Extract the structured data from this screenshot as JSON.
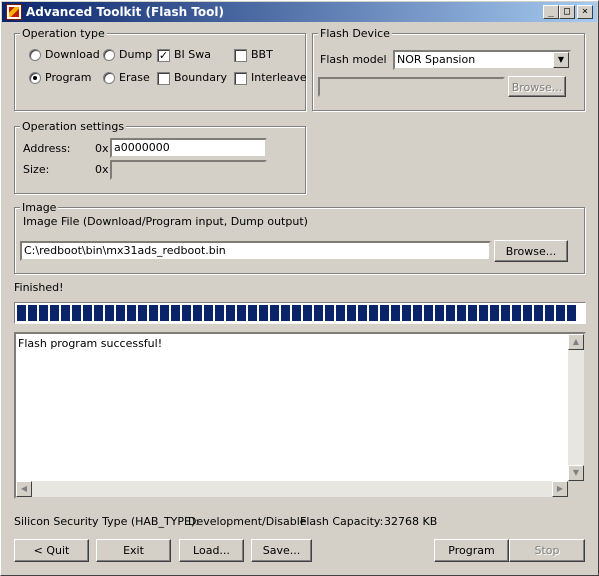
{
  "window": {
    "title": "Advanced Toolkit (Flash Tool)",
    "min_glyph": "_",
    "max_glyph": "□",
    "close_glyph": "×"
  },
  "operation_type": {
    "legend": "Operation type",
    "download": "Download",
    "dump": "Dump",
    "program": "Program",
    "erase": "Erase",
    "bi_swap": "BI Swap",
    "bbt": "BBT",
    "boundary": "Boundary",
    "interleave": "Interleave",
    "selected": "Program",
    "bi_swap_checked": true,
    "bbt_checked": false,
    "boundary_checked": false,
    "interleave_checked": false
  },
  "flash_device": {
    "legend": "Flash Device",
    "model_label": "Flash model",
    "model_value": "NOR Spansion",
    "browse": "Browse..."
  },
  "operation_settings": {
    "legend": "Operation settings",
    "address_label": "Address:",
    "address_prefix": "0x",
    "address_value": "a0000000",
    "size_label": "Size:",
    "size_prefix": "0x",
    "size_value": ""
  },
  "image": {
    "legend": "Image",
    "description": "Image File (Download/Program input, Dump output)",
    "path": "C:\\redboot\\bin\\mx31ads_redboot.bin",
    "browse": "Browse..."
  },
  "status": {
    "text": "Finished!",
    "progress_percent": 100
  },
  "log": {
    "text": "Flash program successful!"
  },
  "info": {
    "hab_label": "Silicon Security Type (HAB_TYPE):",
    "hab_value": "Development/Disable",
    "capacity_label": "Flash Capacity:",
    "capacity_value": "32768 KB"
  },
  "buttons": {
    "quit": "< Quit",
    "exit": "Exit",
    "load": "Load...",
    "save": "Save...",
    "program": "Program",
    "stop": "Stop"
  },
  "colors": {
    "face": "#d4d0c8",
    "title_start": "#0a246a",
    "title_end": "#a6caf0",
    "progress": "#0a246a"
  }
}
